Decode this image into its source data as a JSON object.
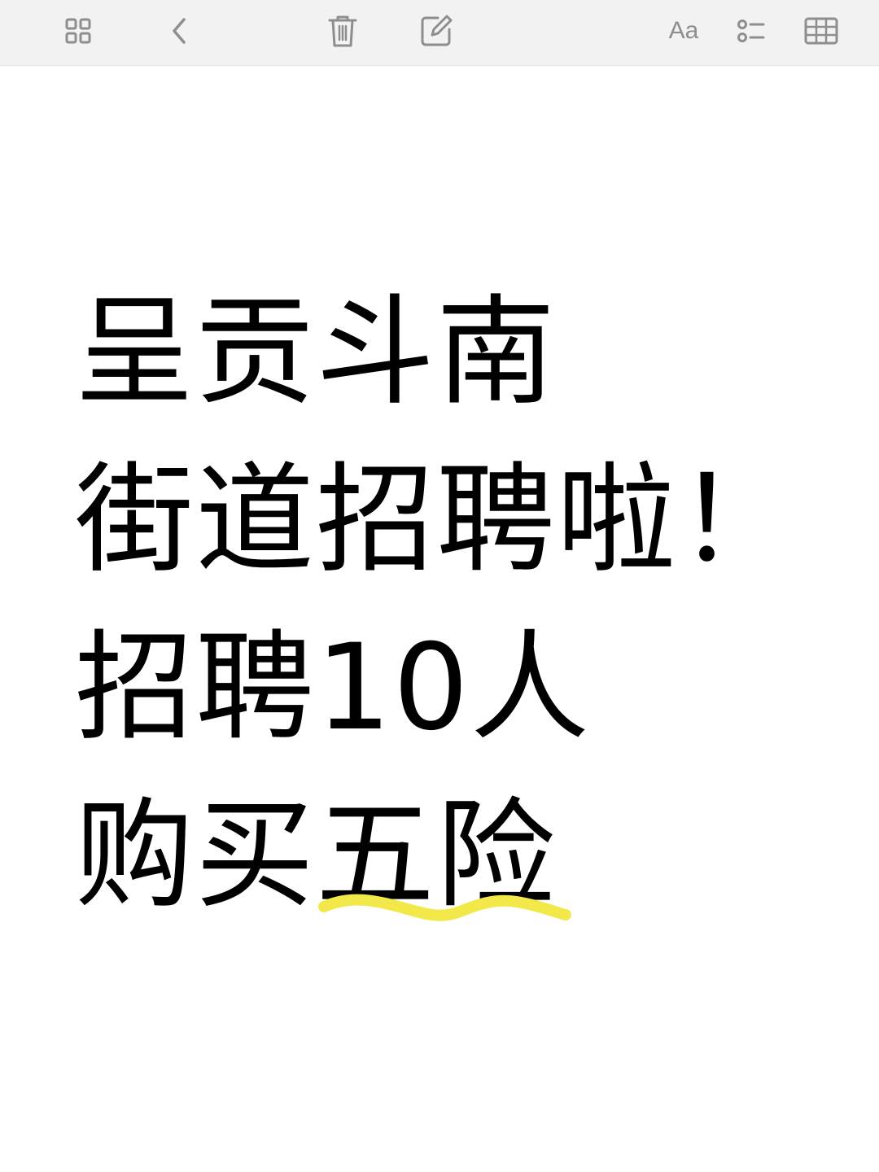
{
  "toolbar": {
    "font_button_label": "Aa",
    "icons": [
      "grid-view-icon",
      "back-chevron-icon",
      "trash-icon",
      "compose-icon",
      "font-format-icon",
      "checklist-icon",
      "table-icon"
    ],
    "icon_color": "#8e8e8e"
  },
  "note": {
    "lines": [
      "呈贡斗南",
      "街道招聘啦！",
      "招聘10人",
      "购买"
    ],
    "highlighted_text": "五险",
    "highlight_color": "#f3e84a",
    "text_color": "#000000"
  }
}
